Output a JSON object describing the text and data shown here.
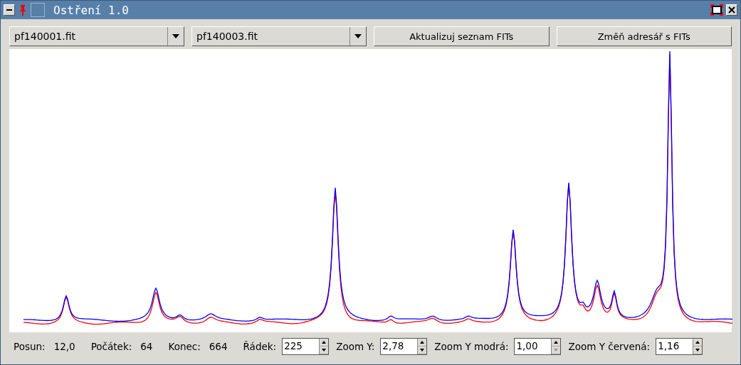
{
  "window": {
    "title": "Ostření 1.0"
  },
  "toolbar": {
    "files": [
      {
        "value": "pf140001.fit"
      },
      {
        "value": "pf140003.fit"
      }
    ],
    "buttons": [
      "Aktualizuj seznam FITs",
      "Změň adresář s FITs"
    ]
  },
  "status": {
    "readouts": [
      {
        "label": "Posun:",
        "value": "12,0"
      },
      {
        "label": "Počátek:",
        "value": "64"
      },
      {
        "label": "Konec:",
        "value": "664"
      }
    ],
    "spinboxes": [
      {
        "label": "Řádek:",
        "value": "225",
        "down_disabled": false
      },
      {
        "label": "Zoom Y:",
        "value": "2,78",
        "down_disabled": false
      },
      {
        "label": "Zoom Y modrá:",
        "value": "1,00",
        "down_disabled": true
      },
      {
        "label": "Zoom Y červená:",
        "value": "1,16",
        "down_disabled": false
      }
    ]
  }
}
